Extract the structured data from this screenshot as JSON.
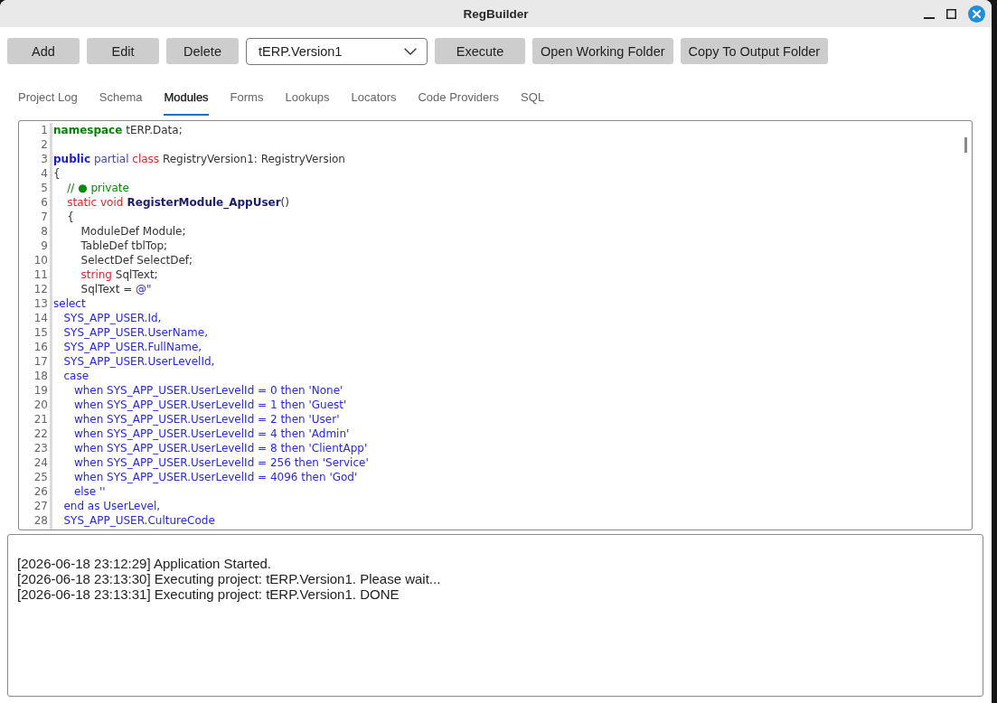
{
  "window": {
    "title": "RegBuilder"
  },
  "toolbar": [
    {
      "kind": "button",
      "label": "Add"
    },
    {
      "kind": "button",
      "label": "Edit"
    },
    {
      "kind": "button",
      "label": "Delete"
    },
    {
      "kind": "dropdown",
      "value": "tERP.Version1"
    },
    {
      "kind": "button",
      "label": "Execute"
    },
    {
      "kind": "button",
      "label": "Open Working Folder"
    },
    {
      "kind": "button",
      "label": "Copy To Output Folder"
    }
  ],
  "tabs": [
    {
      "label": "Project Log",
      "selected": false
    },
    {
      "label": "Schema",
      "selected": false
    },
    {
      "label": "Modules",
      "selected": true
    },
    {
      "label": "Forms",
      "selected": false
    },
    {
      "label": "Lookups",
      "selected": false
    },
    {
      "label": "Locators",
      "selected": false
    },
    {
      "label": "Code Providers",
      "selected": false
    },
    {
      "label": "SQL",
      "selected": false
    }
  ],
  "editor": {
    "lines": [
      {
        "number": "1",
        "tokens": [
          {
            "kind": "directive",
            "text": "namespace"
          },
          {
            "kind": "plain",
            "text": " tERP.Data;"
          }
        ]
      },
      {
        "number": "2"
      },
      {
        "number": "3",
        "tokens": [
          {
            "kind": "access",
            "text": "public"
          },
          {
            "kind": "modifier",
            "text": " partial"
          },
          {
            "kind": "type",
            "text": " class"
          },
          {
            "kind": "plain",
            "text": " RegistryVersion1: RegistryVersion"
          }
        ]
      },
      {
        "number": "4",
        "tokens": [
          {
            "kind": "plain",
            "text": "{"
          }
        ]
      },
      {
        "number": "5",
        "tokens": [
          {
            "kind": "comment",
            "text": "    // ● private"
          }
        ]
      },
      {
        "number": "6",
        "tokens": [
          {
            "kind": "type",
            "text": "    static void"
          },
          {
            "kind": "method",
            "text": " RegisterModule_AppUser"
          },
          {
            "kind": "plain",
            "text": "()"
          }
        ]
      },
      {
        "number": "7",
        "tokens": [
          {
            "kind": "plain",
            "text": "    {"
          }
        ]
      },
      {
        "number": "8",
        "tokens": [
          {
            "kind": "plain",
            "text": "        ModuleDef Module;"
          }
        ]
      },
      {
        "number": "9",
        "tokens": [
          {
            "kind": "plain",
            "text": "        TableDef tblTop;"
          }
        ]
      },
      {
        "number": "10",
        "tokens": [
          {
            "kind": "plain",
            "text": "        SelectDef SelectDef;"
          }
        ]
      },
      {
        "number": "11",
        "tokens": [
          {
            "kind": "type",
            "text": "        string"
          },
          {
            "kind": "plain",
            "text": " SqlText;"
          }
        ]
      },
      {
        "number": "12",
        "tokens": [
          {
            "kind": "plain",
            "text": "        SqlText = "
          },
          {
            "kind": "string",
            "text": "@\""
          }
        ]
      },
      {
        "number": "13",
        "tokens": [
          {
            "kind": "string",
            "text": "select"
          }
        ]
      },
      {
        "number": "14",
        "tokens": [
          {
            "kind": "string",
            "text": "   SYS_APP_USER.Id,"
          }
        ]
      },
      {
        "number": "15",
        "tokens": [
          {
            "kind": "string",
            "text": "   SYS_APP_USER.UserName,"
          }
        ]
      },
      {
        "number": "16",
        "tokens": [
          {
            "kind": "string",
            "text": "   SYS_APP_USER.FullName,"
          }
        ]
      },
      {
        "number": "17",
        "tokens": [
          {
            "kind": "string",
            "text": "   SYS_APP_USER.UserLevelId,"
          }
        ]
      },
      {
        "number": "18",
        "tokens": [
          {
            "kind": "string",
            "text": "   case"
          }
        ]
      },
      {
        "number": "19",
        "tokens": [
          {
            "kind": "string",
            "text": "      when SYS_APP_USER.UserLevelId = 0 then 'None'"
          }
        ]
      },
      {
        "number": "20",
        "tokens": [
          {
            "kind": "string",
            "text": "      when SYS_APP_USER.UserLevelId = 1 then 'Guest'"
          }
        ]
      },
      {
        "number": "21",
        "tokens": [
          {
            "kind": "string",
            "text": "      when SYS_APP_USER.UserLevelId = 2 then 'User'"
          }
        ]
      },
      {
        "number": "22",
        "tokens": [
          {
            "kind": "string",
            "text": "      when SYS_APP_USER.UserLevelId = 4 then 'Admin'"
          }
        ]
      },
      {
        "number": "23",
        "tokens": [
          {
            "kind": "string",
            "text": "      when SYS_APP_USER.UserLevelId = 8 then 'ClientApp'"
          }
        ]
      },
      {
        "number": "24",
        "tokens": [
          {
            "kind": "string",
            "text": "      when SYS_APP_USER.UserLevelId = 256 then 'Service'"
          }
        ]
      },
      {
        "number": "25",
        "tokens": [
          {
            "kind": "string",
            "text": "      when SYS_APP_USER.UserLevelId = 4096 then 'God'"
          }
        ]
      },
      {
        "number": "26",
        "tokens": [
          {
            "kind": "string",
            "text": "      else ''"
          }
        ]
      },
      {
        "number": "27",
        "tokens": [
          {
            "kind": "string",
            "text": "   end as UserLevel,"
          }
        ]
      },
      {
        "number": "28",
        "tokens": [
          {
            "kind": "string",
            "text": "   SYS_APP_USER.CultureCode"
          }
        ]
      }
    ]
  },
  "log": {
    "lines": [
      "[2026-06-18 23:12:29] Application Started.",
      "[2026-06-18 23:13:30] Executing project: tERP.Version1. Please wait...",
      "[2026-06-18 23:13:31] Executing project: tERP.Version1. DONE"
    ]
  }
}
